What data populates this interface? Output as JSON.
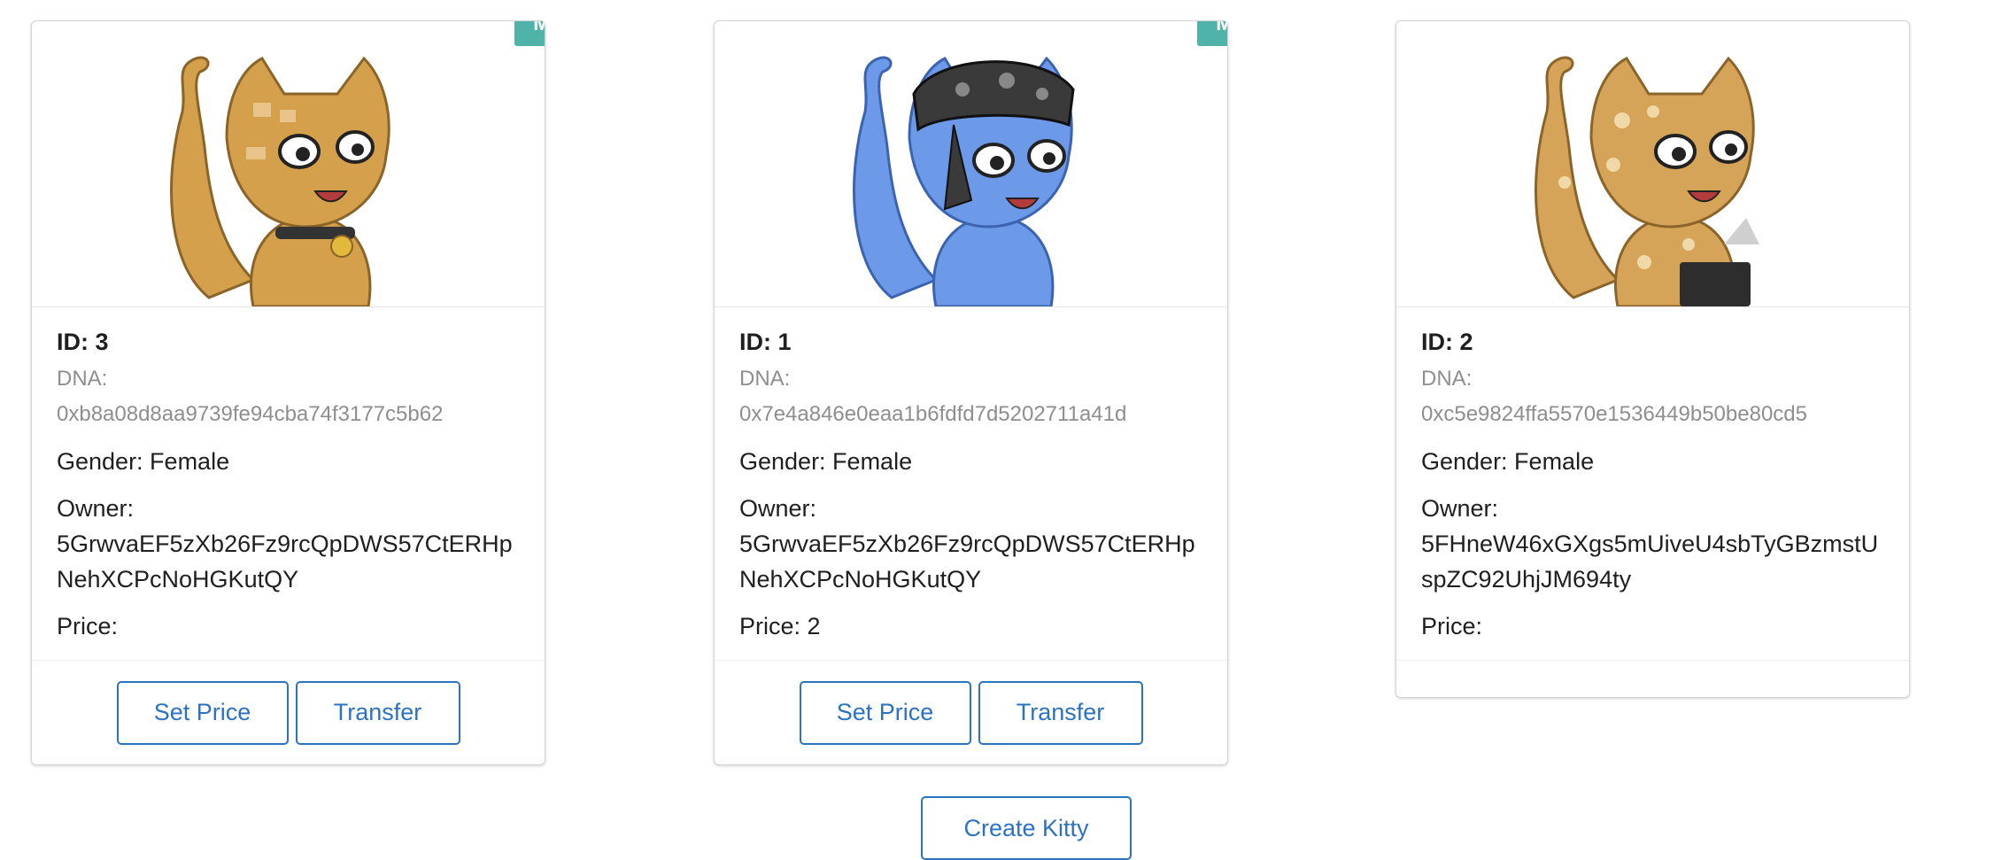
{
  "kitties": [
    {
      "mine_badge": "Mine",
      "id_label": "ID: 3",
      "dna_label": "DNA:",
      "dna": "0xb8a08d8aa9739fe94cba74f3177c5b62",
      "gender": "Gender: Female",
      "owner_label": "Owner:",
      "owner": "5GrwvaEF5zXb26Fz9rcQpDWS57CtERHpNehXCPcNoHGKutQY",
      "price": "Price:",
      "set_price_label": "Set Price",
      "transfer_label": "Transfer",
      "colors": {
        "fur": "#d4a04c",
        "patch": "#e8c48a",
        "stroke": "#8a6428"
      }
    },
    {
      "mine_badge": "Mine",
      "id_label": "ID: 1",
      "dna_label": "DNA:",
      "dna": "0x7e4a846e0eaa1b6fdfd7d5202711a41d",
      "gender": "Gender: Female",
      "owner_label": "Owner:",
      "owner": "5GrwvaEF5zXb26Fz9rcQpDWS57CtERHpNehXCPcNoHGKutQY",
      "price": "Price: 2",
      "set_price_label": "Set Price",
      "transfer_label": "Transfer",
      "colors": {
        "fur": "#6c9ae8",
        "patch": "#9cbdf0",
        "stroke": "#3b63b0"
      }
    },
    {
      "id_label": "ID: 2",
      "dna_label": "DNA:",
      "dna": "0xc5e9824ffa5570e1536449b50be80cd5",
      "gender": "Gender: Female",
      "owner_label": "Owner:",
      "owner": "5FHneW46xGXgs5mUiveU4sbTyGBzmstUspZC92UhjJM694ty",
      "price": "Price:",
      "colors": {
        "fur": "#d6a458",
        "patch": "#f0d8a8",
        "stroke": "#8a6428"
      }
    }
  ],
  "create_button_label": "Create Kitty"
}
